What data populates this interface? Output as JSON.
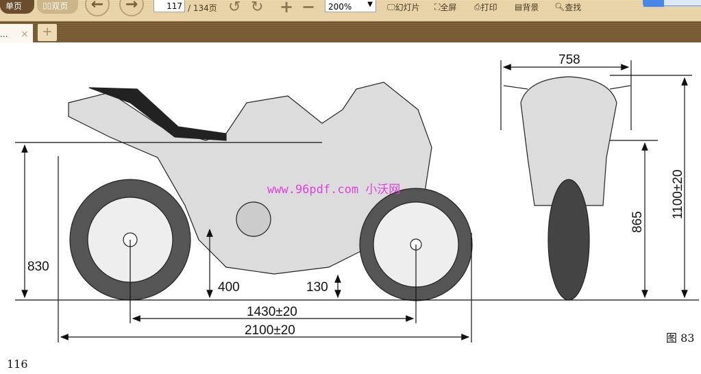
{
  "toolbar": {
    "single_page": "单页",
    "double_page": "双页",
    "page_current": "117",
    "page_total": "/ 134页",
    "zoom_level": "200%",
    "slideshow": "幻灯片",
    "fullscreen": "全屏",
    "print": "打印",
    "background": "背景",
    "find": "查找"
  },
  "tabs": {
    "active_label": "...",
    "close": "×",
    "add": "+"
  },
  "diagram": {
    "front_width": "758",
    "total_height": "1100±20",
    "mirror_height": "865",
    "seat_height": "830",
    "ground_clearance_engine": "400",
    "ground_clearance": "130",
    "wheelbase": "1430±20",
    "total_length": "2100±20",
    "watermark": "www.96pdf.com 小沃网"
  },
  "page": {
    "figure_label": "图 83",
    "page_number": "116"
  }
}
